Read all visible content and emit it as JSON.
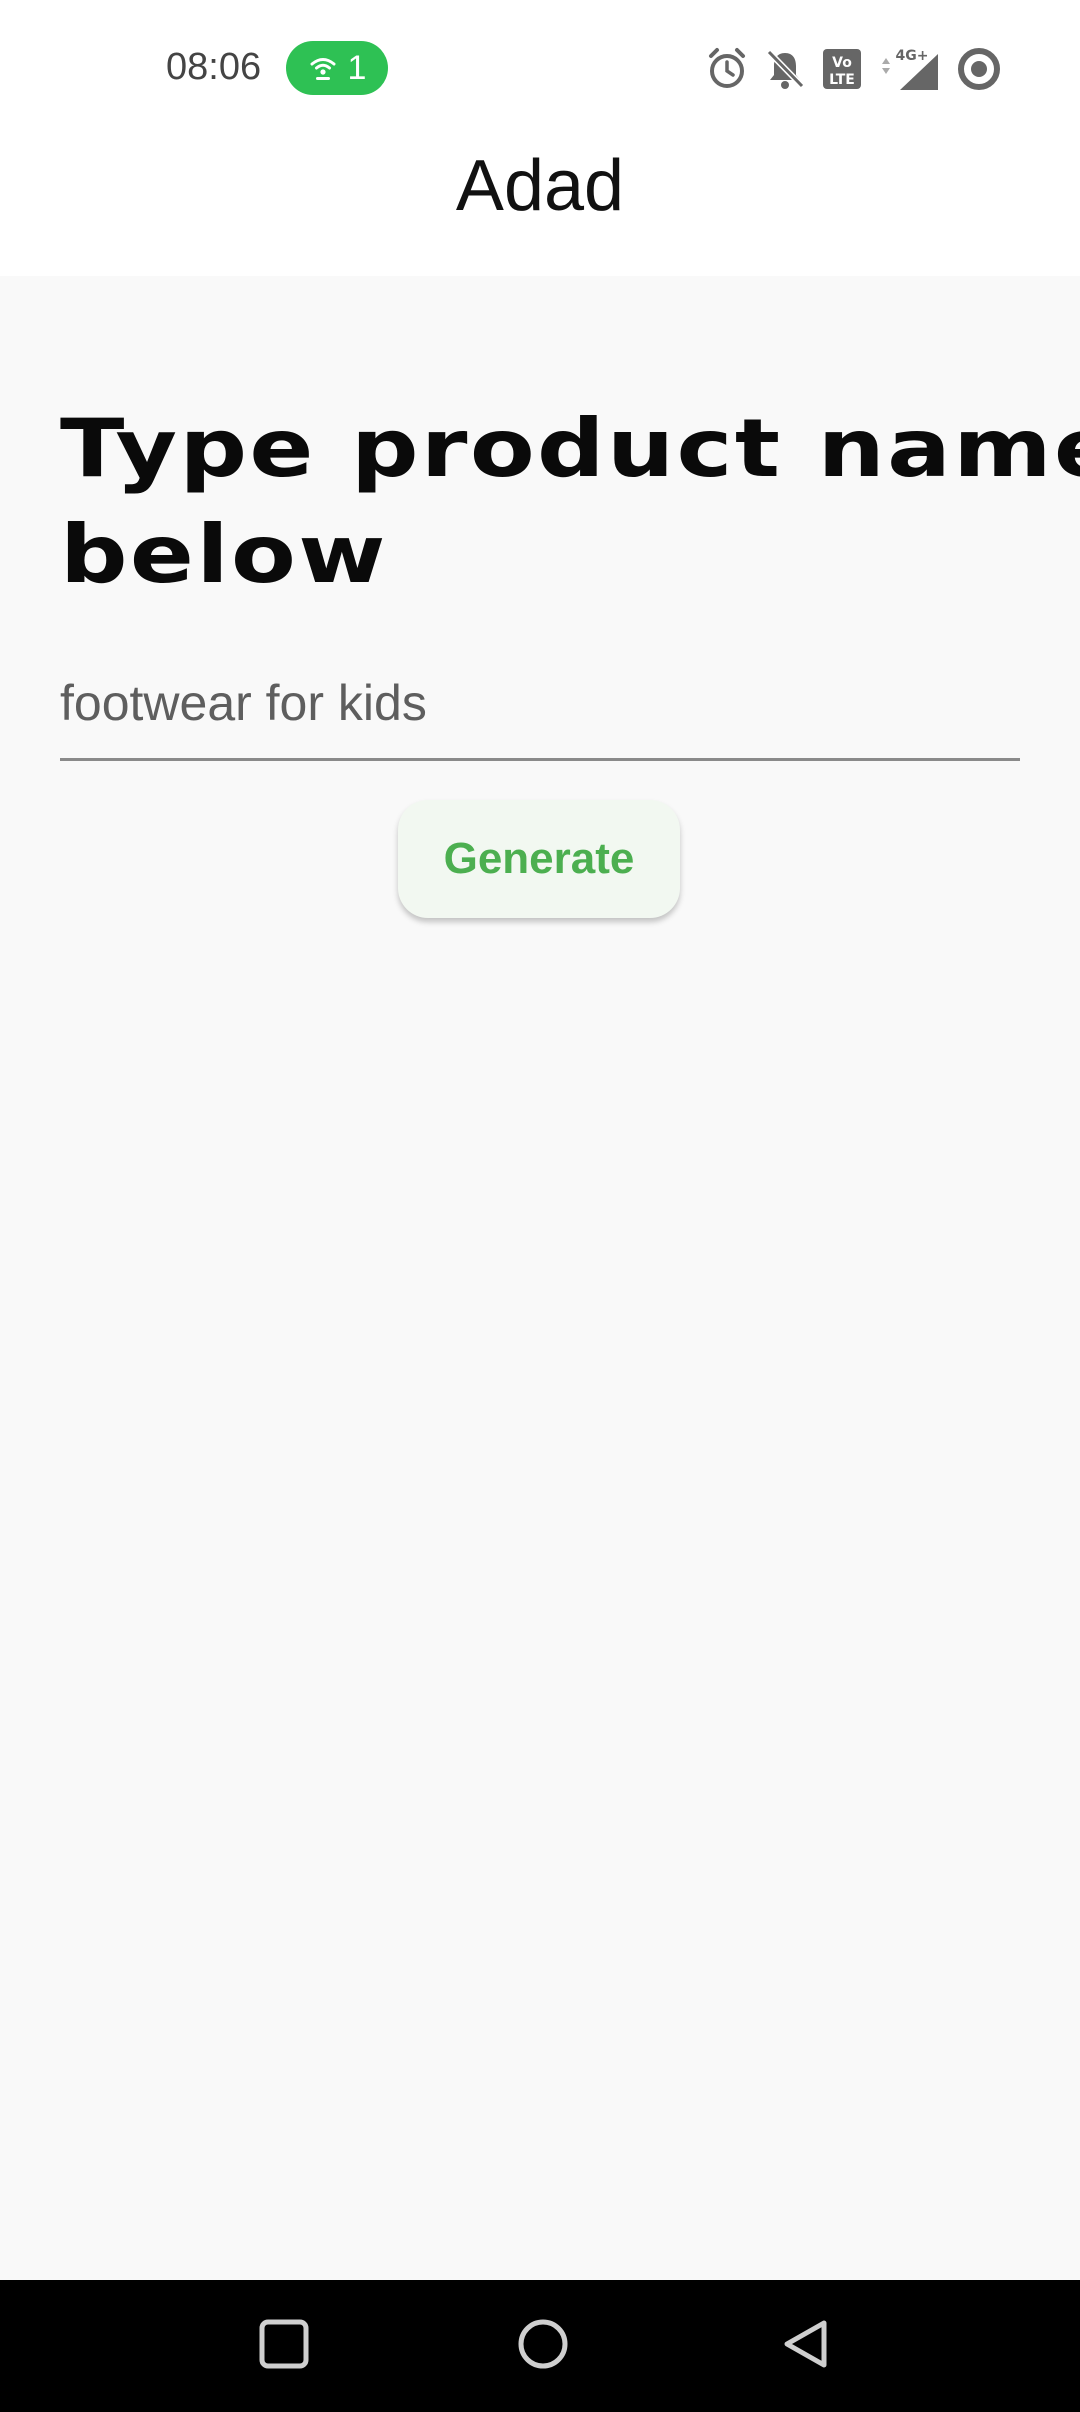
{
  "status_bar": {
    "time": "08:06",
    "hotspot_count": "1",
    "icons": [
      "hotspot-icon",
      "alarm-icon",
      "bell-off-icon",
      "volte-icon",
      "signal-4g-icon",
      "data-saver-icon"
    ],
    "volte_label": "Vo LTE",
    "network_label": "4G+"
  },
  "app_bar": {
    "title": "Adad"
  },
  "main": {
    "heading": "Type product name below",
    "input": {
      "value": "footwear for kids",
      "placeholder": ""
    },
    "generate_label": "Generate"
  },
  "nav_bar": {
    "icons": [
      "recents-icon",
      "home-icon",
      "back-icon"
    ]
  },
  "colors": {
    "accent": "#4caf50",
    "hotspot": "#2ec154",
    "background": "#f9f9f9"
  }
}
